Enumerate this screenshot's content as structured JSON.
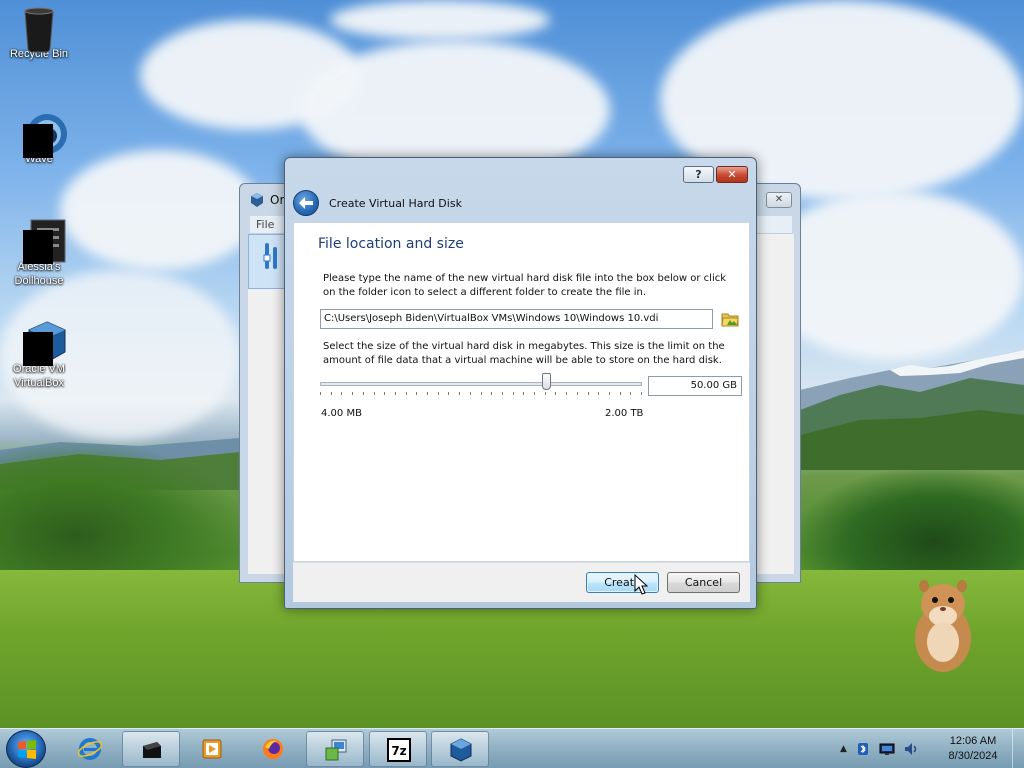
{
  "desktop": {
    "icons": [
      {
        "label": "Recycle Bin"
      },
      {
        "label": "Wave"
      },
      {
        "label": "Alessia's Dollhouse"
      },
      {
        "label": "Oracle VM VirtualBox"
      }
    ]
  },
  "background_window": {
    "title": "Or",
    "menu_file": "File",
    "close_glyph": "✕"
  },
  "dialog": {
    "title": "Create Virtual Hard Disk",
    "help_glyph": "?",
    "close_glyph": "✕",
    "section_title": "File location and size",
    "instruction": "Please type the name of the new virtual hard disk file into the box below or click on the folder icon to select a different folder to create the file in.",
    "file_path": "C:\\Users\\Joseph Biden\\VirtualBox VMs\\Windows 10\\Windows 10.vdi",
    "size_instruction": "Select the size of the virtual hard disk in megabytes. This size is the limit on the amount of file data that a virtual machine will be able to store on the hard disk.",
    "size_value": "50.00 GB",
    "range_min": "4.00 MB",
    "range_max": "2.00 TB",
    "slider_position": 0.71,
    "create_label": "Create",
    "cancel_label": "Cancel"
  },
  "taskbar": {
    "clock_time": "12:06 AM",
    "clock_date": "8/30/2024",
    "items": [
      "internet-explorer",
      "terminal",
      "media-player",
      "firefox",
      "installer",
      "7zip",
      "virtualbox"
    ],
    "tray_arrow": "▲"
  },
  "colors": {
    "accent_title": "#1e3f78",
    "close_red": "#c74a33",
    "create_blue": "#bee6fd"
  }
}
